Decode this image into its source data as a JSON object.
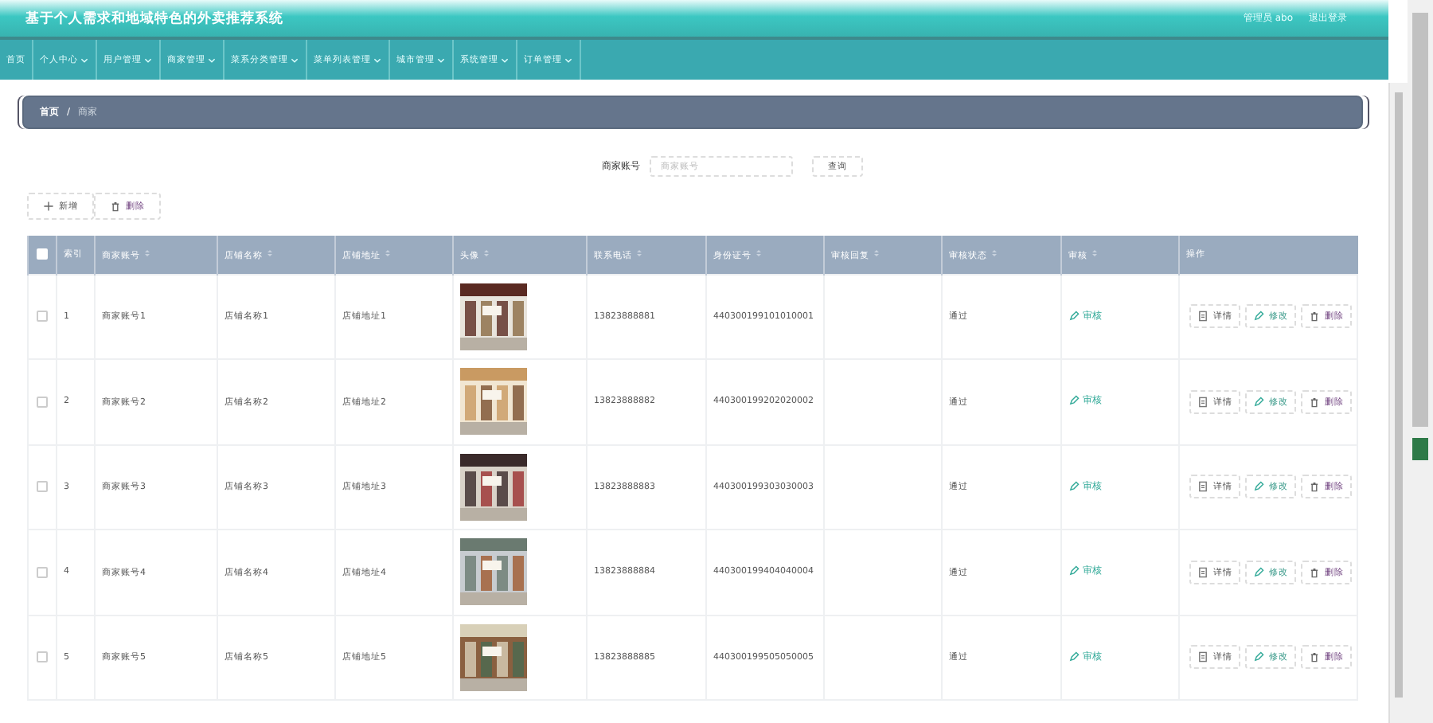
{
  "header": {
    "title": "基于个人需求和地域特色的外卖推荐系统",
    "user": "管理员 abo",
    "logout": "退出登录"
  },
  "nav": [
    {
      "label": "首页",
      "dropdown": false
    },
    {
      "label": "个人中心",
      "dropdown": true
    },
    {
      "label": "用户管理",
      "dropdown": true
    },
    {
      "label": "商家管理",
      "dropdown": true
    },
    {
      "label": "菜系分类管理",
      "dropdown": true
    },
    {
      "label": "菜单列表管理",
      "dropdown": true
    },
    {
      "label": "城市管理",
      "dropdown": true
    },
    {
      "label": "系统管理",
      "dropdown": true
    },
    {
      "label": "订单管理",
      "dropdown": true
    }
  ],
  "breadcrumb": {
    "items": [
      "首页",
      "商家"
    ],
    "separator": "/"
  },
  "search": {
    "label": "商家账号",
    "placeholder": "商家账号",
    "button": "查询"
  },
  "toolbar": [
    {
      "label": "新增",
      "kind": "add"
    },
    {
      "label": "删除",
      "kind": "delete"
    }
  ],
  "table": {
    "select_all": false,
    "columns": [
      {
        "label": "索引",
        "sortable": false
      },
      {
        "label": "商家账号",
        "sortable": true
      },
      {
        "label": "店铺名称",
        "sortable": true
      },
      {
        "label": "店铺地址",
        "sortable": true
      },
      {
        "label": "头像",
        "sortable": true
      },
      {
        "label": "联系电话",
        "sortable": true
      },
      {
        "label": "身份证号",
        "sortable": true
      },
      {
        "label": "审核回复",
        "sortable": true
      },
      {
        "label": "审核状态",
        "sortable": true
      },
      {
        "label": "审核",
        "sortable": true
      },
      {
        "label": "操作",
        "sortable": false
      }
    ],
    "rows": [
      {
        "checked": false,
        "cells": [
          "1",
          "商家账号1",
          "店铺名称1",
          "店铺地址1",
          {
            "kind": "picture"
          },
          "13823888881",
          "440300199101010001",
          "",
          "通过"
        ],
        "review": "审核",
        "actions": [
          "详情",
          "修改",
          "删除"
        ]
      },
      {
        "checked": false,
        "cells": [
          "2",
          "商家账号2",
          "店铺名称2",
          "店铺地址2",
          {
            "kind": "picture"
          },
          "13823888882",
          "440300199202020002",
          "",
          "通过"
        ],
        "review": "审核",
        "actions": [
          "详情",
          "修改",
          "删除"
        ]
      },
      {
        "checked": false,
        "cells": [
          "3",
          "商家账号3",
          "店铺名称3",
          "店铺地址3",
          {
            "kind": "picture"
          },
          "13823888883",
          "440300199303030003",
          "",
          "通过"
        ],
        "review": "审核",
        "actions": [
          "详情",
          "修改",
          "删除"
        ]
      },
      {
        "checked": false,
        "cells": [
          "4",
          "商家账号4",
          "店铺名称4",
          "店铺地址4",
          {
            "kind": "picture"
          },
          "13823888884",
          "440300199404040004",
          "",
          "通过"
        ],
        "review": "审核",
        "actions": [
          "详情",
          "修改",
          "删除"
        ]
      },
      {
        "checked": false,
        "cells": [
          "5",
          "商家账号5",
          "店铺名称5",
          "店铺地址5",
          {
            "kind": "picture"
          },
          "13823888885",
          "440300199505050005",
          "",
          "通过"
        ],
        "review": "审核",
        "actions": [
          "详情",
          "修改",
          "删除"
        ]
      }
    ]
  }
}
